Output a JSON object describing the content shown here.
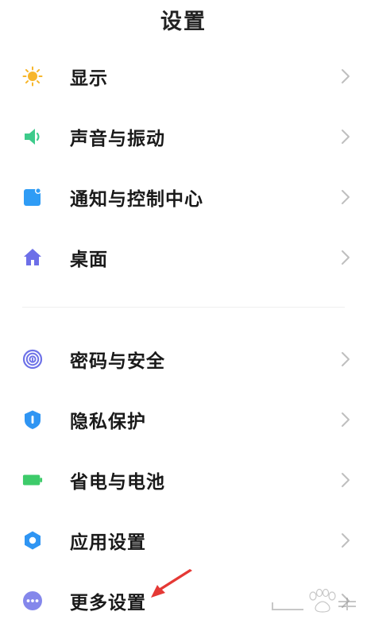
{
  "header": {
    "title": "设置"
  },
  "items": [
    {
      "label": "显示",
      "icon": "sun-icon",
      "color": "#F7B62B"
    },
    {
      "label": "声音与振动",
      "icon": "speaker-icon",
      "color": "#3DCB8B"
    },
    {
      "label": "通知与控制中心",
      "icon": "notification-icon",
      "color": "#2F9CF5"
    },
    {
      "label": "桌面",
      "icon": "home-icon",
      "color": "#6D6FE8"
    },
    {
      "label": "密码与安全",
      "icon": "fingerprint-icon",
      "color": "#6E72E8"
    },
    {
      "label": "隐私保护",
      "icon": "privacy-shield-icon",
      "color": "#2F95F3"
    },
    {
      "label": "省电与电池",
      "icon": "battery-icon",
      "color": "#3DCB6A"
    },
    {
      "label": "应用设置",
      "icon": "gear-icon",
      "color": "#2F95F3"
    },
    {
      "label": "更多设置",
      "icon": "more-icon",
      "color": "#6E72E8"
    }
  ],
  "colors": {
    "chevron": "#BFBFBF",
    "annotation_arrow": "#E53935"
  }
}
